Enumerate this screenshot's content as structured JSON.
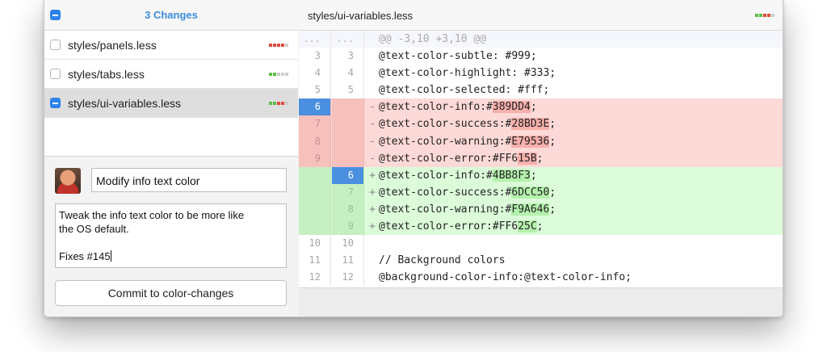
{
  "changes": {
    "title": "3 Changes",
    "files": [
      {
        "name": "styles/panels.less",
        "checked": "unchecked",
        "stat": [
          "#e04a3f",
          "#e04a3f",
          "#e04a3f",
          "#e04a3f",
          "#cccccc"
        ]
      },
      {
        "name": "styles/tabs.less",
        "checked": "unchecked",
        "stat": [
          "#5bbd47",
          "#5bbd47",
          "#cccccc",
          "#cccccc",
          "#cccccc"
        ]
      },
      {
        "name": "styles/ui-variables.less",
        "checked": "partial",
        "selected": true,
        "stat": [
          "#5bbd47",
          "#5bbd47",
          "#e04a3f",
          "#e04a3f",
          "#cccccc"
        ]
      }
    ]
  },
  "commit": {
    "summary": "Modify info text color",
    "description": "Tweak the info text color to be more like\nthe OS default.\n\nFixes #145",
    "button_label": "Commit to color-changes"
  },
  "diff": {
    "path": "styles/ui-variables.less",
    "header_stat": [
      "#5bbd47",
      "#5bbd47",
      "#e04a3f",
      "#e04a3f",
      "#cccccc"
    ],
    "colors": {
      "deletion": "#fdd9d7",
      "addition": "#dbfbd9",
      "selected_line": "#4a8fe0"
    },
    "lines": [
      {
        "type": "hunk",
        "old": "...",
        "new": "...",
        "mark": "",
        "pre": "@@ -3,10 +3,10 @@",
        "hl": "",
        "post": ""
      },
      {
        "type": "ctx",
        "old": "3",
        "new": "3",
        "mark": "",
        "pre": "@text-color-subtle: #999;",
        "hl": "",
        "post": ""
      },
      {
        "type": "ctx",
        "old": "4",
        "new": "4",
        "mark": "",
        "pre": "@text-color-highlight: #333;",
        "hl": "",
        "post": ""
      },
      {
        "type": "ctx",
        "old": "5",
        "new": "5",
        "mark": "",
        "pre": "@text-color-selected: #fff;",
        "hl": "",
        "post": ""
      },
      {
        "type": "del",
        "old": "6",
        "new": "",
        "mark": "-",
        "pre": "@text-color-info:#",
        "hl": "389DD4",
        "post": ";",
        "selected": "old"
      },
      {
        "type": "del",
        "old": "7",
        "new": "",
        "mark": "-",
        "pre": "@text-color-success:#",
        "hl": "28BD3E",
        "post": ";"
      },
      {
        "type": "del",
        "old": "8",
        "new": "",
        "mark": "-",
        "pre": "@text-color-warning:#",
        "hl": "E79536",
        "post": ";"
      },
      {
        "type": "del",
        "old": "9",
        "new": "",
        "mark": "-",
        "pre": "@text-color-error:#FF6",
        "hl": "15B",
        "post": ";"
      },
      {
        "type": "add",
        "old": "",
        "new": "6",
        "mark": "+",
        "pre": "@text-color-info:#",
        "hl": "4BB8F3",
        "post": ";",
        "selected": "new"
      },
      {
        "type": "add",
        "old": "",
        "new": "7",
        "mark": "+",
        "pre": "@text-color-success:#",
        "hl": "6DCC50",
        "post": ";"
      },
      {
        "type": "add",
        "old": "",
        "new": "8",
        "mark": "+",
        "pre": "@text-color-warning:#",
        "hl": "F9A646",
        "post": ";"
      },
      {
        "type": "add",
        "old": "",
        "new": "9",
        "mark": "+",
        "pre": "@text-color-error:#FF6",
        "hl": "25C",
        "post": ";"
      },
      {
        "type": "ctx",
        "old": "10",
        "new": "10",
        "mark": "",
        "pre": "",
        "hl": "",
        "post": ""
      },
      {
        "type": "ctx",
        "old": "11",
        "new": "11",
        "mark": "",
        "pre": "// Background colors",
        "hl": "",
        "post": ""
      },
      {
        "type": "ctx",
        "old": "12",
        "new": "12",
        "mark": "",
        "pre": "@background-color-info:@text-color-info;",
        "hl": "",
        "post": ""
      }
    ]
  }
}
